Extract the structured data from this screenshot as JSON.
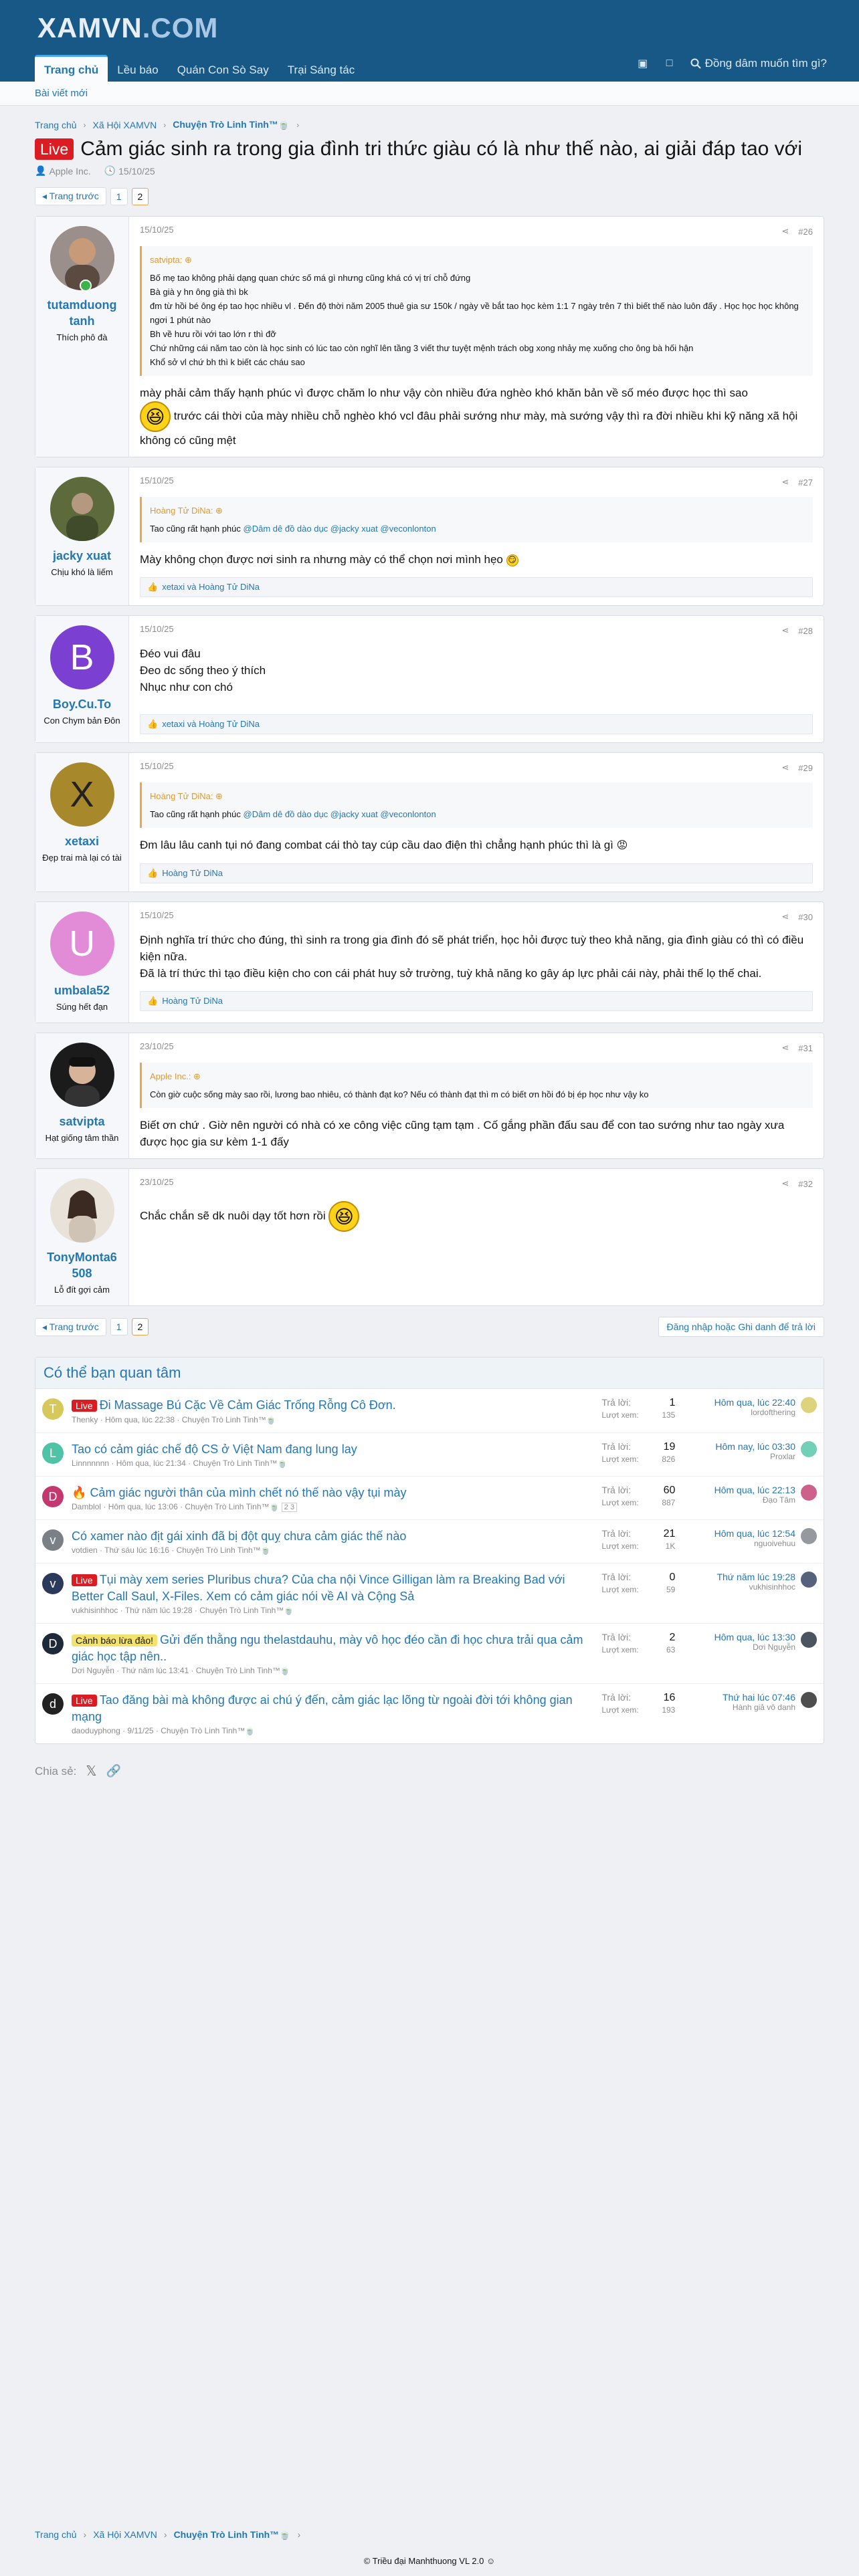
{
  "header": {
    "logo_main": "XAMVN",
    "logo_suffix": ".COM",
    "nav": [
      "Trang chủ",
      "Lều báo",
      "Quán Con Sò Say",
      "Trại Sáng tác"
    ],
    "search_label": "Đồng dâm muốn tìm gì?",
    "subnav": "Bài viết mới"
  },
  "breadcrumb": [
    "Trang chủ",
    "Xã Hội XAMVN",
    "Chuyện Trò Linh Tinh™🍵"
  ],
  "thread": {
    "prefix": "Live",
    "title": "Cảm giác sinh ra trong gia đình tri thức giàu có là như thế nào, ai giải đáp tao với",
    "author": "Apple Inc.",
    "date": "15/10/25"
  },
  "pager": {
    "prev": "◂ Trang trước",
    "pages": [
      "1",
      "2"
    ]
  },
  "posts": [
    {
      "user": "tutamduong tanh",
      "title": "Thích phô đà",
      "date": "15/10/25",
      "num": "#26",
      "quote_author": "satvipta: ⊕",
      "quote_lines": [
        "Bố mẹ tao không phải dạng quan chức số má gì nhưng cũng khá có vị trí chỗ đứng",
        "Bà già y hn ông già thì bk",
        "đm từ hồi bé ông ép tao học nhiều vl . Đến độ thời năm 2005 thuê gia sư 150k / ngày về bắt tao học kèm 1:1 7 ngày trên 7 thì biết thế nào luôn đấy . Học học học không ngơi 1 phút nào",
        "Bh về hưu rồi với tao lớn r thì đỡ",
        "Chứ những cái năm tao còn là học sinh có lúc tao còn nghĩ lên tầng 3 viết thư tuyệt mệnh trách obg xong nhảy mẹ xuống cho ông bà hối hận",
        "Khổ sở vl chứ bh thì k biết các cháu sao"
      ],
      "body_1": "mày phải cảm thấy hạnh phúc vì được chăm lo như vậy còn nhiều đứa nghèo khó khăn bản về số méo được học thì sao",
      "body_2": "trước cái thời của mày nhiều chỗ nghèo khó vcl đâu phải sướng như mày, mà sướng vậy thì ra đời nhiều khi kỹ năng xã hội không có cũng mệt"
    },
    {
      "user": "jacky xuat",
      "title": "Chịu khó là liếm",
      "date": "15/10/25",
      "num": "#27",
      "quote_author": "Hoàng Tử DiNa: ⊕",
      "quote_text": "Tao cũng rất hạnh phúc",
      "quote_mentions": "@Dâm dê đồ dào dục @jacky xuat @veconlonton",
      "body": "Mày không chọn được nơi sinh ra nhưng mày có thể chọn nơi mình hẹo",
      "reactions": "xetaxi và Hoàng Tử DiNa"
    },
    {
      "user": "Boy.Cu.To",
      "title": "Con Chym bản Đôn",
      "date": "15/10/25",
      "num": "#28",
      "body_lines": [
        "Đéo vui đâu",
        "Đeo dc sống theo ý thích",
        "Nhục như con chó"
      ],
      "reactions": "xetaxi và Hoàng Tử DiNa"
    },
    {
      "user": "xetaxi",
      "title": "Đẹp trai mà lại có tài",
      "date": "15/10/25",
      "num": "#29",
      "quote_author": "Hoàng Tử DiNa: ⊕",
      "quote_text": "Tao cũng rất hạnh phúc",
      "quote_mentions": "@Dâm dê đồ dào dục @jacky xuat @veconlonton",
      "body": "Đm lâu lâu canh tụi nó đang combat cái thò tay cúp cầu dao điện thì chẳng hạnh phúc thì là gì",
      "reactions": "Hoàng Tử DiNa"
    },
    {
      "user": "umbala52",
      "title": "Súng hết đạn",
      "date": "15/10/25",
      "num": "#30",
      "body_lines": [
        "Định nghĩa trí thức cho đúng, thì sinh ra trong gia đình đó sẽ phát triển, học hỏi được tuỳ theo khả năng, gia đình giàu có thì có điều kiện nữa.",
        "Đã là trí thức thì tạo điều kiện cho con cái phát huy sở trường, tuỳ khả năng ko gây áp lực phải cái này, phải thế lọ thế chai."
      ],
      "reactions": "Hoàng Tử DiNa"
    },
    {
      "user": "satvipta",
      "title": "Hạt giống tâm thần",
      "date": "23/10/25",
      "num": "#31",
      "quote_author": "Apple Inc.: ⊕",
      "quote_text": "Còn giờ cuộc sống mày sao rồi, lương bao nhiêu, có thành đạt ko? Nếu có thành đạt thì m có biết ơn hồi đó bị ép học như vậy ko",
      "body": "Biết ơn chứ . Giờ nên người có nhà có xe công việc cũng tạm tạm . Cố gắng phần đấu sau để con tao sướng như tao ngày xưa được học gia sư kèm 1-1 đấy"
    },
    {
      "user": "TonyMonta6 508",
      "title": "Lỗ đít gợi cảm",
      "date": "23/10/25",
      "num": "#32",
      "body": "Chắc chắn sẽ dk nuôi dạy tốt hơn rồi"
    }
  ],
  "login_reply": "Đăng nhập hoặc Ghi danh để trả lời",
  "related": {
    "heading": "Có thể bạn quan tâm",
    "reply_label": "Trả lời:",
    "view_label": "Lượt xem:",
    "items": [
      {
        "prefix": "Live",
        "title": "Đi Massage Bú Cặc Về Cảm Giác Trống Rỗng Cô Đơn.",
        "author": "Thenky",
        "time": "Hôm qua, lúc 22:38",
        "forum": "Chuyện Trò Linh Tinh™🍵",
        "replies": "1",
        "views": "135",
        "last_time": "Hôm qua, lúc 22:40",
        "last_user": "lordofthering",
        "color": "#d6c85b",
        "letter": "T"
      },
      {
        "prefix": "",
        "title": "Tao có cảm giác chế độ CS ở Việt Nam đang lung lay",
        "author": "Linnnnnnn",
        "time": "Hôm qua, lúc 21:34",
        "forum": "Chuyện Trò Linh Tinh™🍵",
        "replies": "19",
        "views": "826",
        "last_time": "Hôm nay, lúc 03:30",
        "last_user": "Proxlar",
        "color": "#4fc3a6",
        "letter": "L"
      },
      {
        "prefix": "🔥",
        "title": "Cảm giác người thân của mình chết nó thế nào vậy tụi mày",
        "author": "Damblol",
        "time": "Hôm qua, lúc 13:06",
        "forum": "Chuyện Trò Linh Tinh™🍵",
        "pages": "2 3",
        "replies": "60",
        "views": "887",
        "last_time": "Hôm qua, lúc 22:13",
        "last_user": "Đạo Tâm",
        "color": "#c2386f",
        "letter": "D"
      },
      {
        "prefix": "",
        "title": "Có xamer nào địt gái xinh đã bị đột quỵ chưa cảm giác thế nào",
        "author": "votdien",
        "time": "Thứ sáu lúc 16:16",
        "forum": "Chuyện Trò Linh Tinh™🍵",
        "replies": "21",
        "views": "1K",
        "last_time": "Hôm qua, lúc 12:54",
        "last_user": "nguoivehuu",
        "color": "#7b7f86",
        "letter": "v"
      },
      {
        "prefix": "Live",
        "title": "Tụi mày xem series Pluribus chưa? Của cha nội Vince Gilligan làm ra Breaking Bad với Better Call Saul, X-Files. Xem có cảm giác nói về AI và Cộng Sả",
        "author": "vukhisinhhoc",
        "time": "Thứ năm lúc 19:28",
        "forum": "Chuyện Trò Linh Tinh™🍵",
        "replies": "0",
        "views": "59",
        "last_time": "Thứ năm lúc 19:28",
        "last_user": "vukhisinhhoc",
        "color": "#2b3a5c",
        "letter": "v"
      },
      {
        "prefix": "Cảnh báo lừa đảo!",
        "warn": true,
        "title": "Gửi đến thằng ngu thelastdauhu, mày vô học đéo cần đi học chưa trải qua cảm giác học tập nên..",
        "author": "Dơi Nguyễn",
        "time": "Thứ năm lúc 13:41",
        "forum": "Chuyện Trò Linh Tinh™🍵",
        "replies": "2",
        "views": "63",
        "last_time": "Hôm qua, lúc 13:30",
        "last_user": "Dơi Nguyễn",
        "color": "#1e2a3a",
        "letter": "D"
      },
      {
        "prefix": "Live",
        "title": "Tao đăng bài mà không được ai chú ý đến, cảm giác lạc lõng từ ngoài đời tới không gian mạng",
        "author": "daoduyphong",
        "time": "9/11/25",
        "forum": "Chuyện Trò Linh Tinh™🍵",
        "replies": "16",
        "views": "193",
        "last_time": "Thứ hai lúc 07:46",
        "last_user": "Hành giả vô danh",
        "color": "#222",
        "letter": "d"
      }
    ]
  },
  "share_label": "Chia sẻ:",
  "copyright": "© Triều đại Manhthuong VL 2.0 ☺"
}
